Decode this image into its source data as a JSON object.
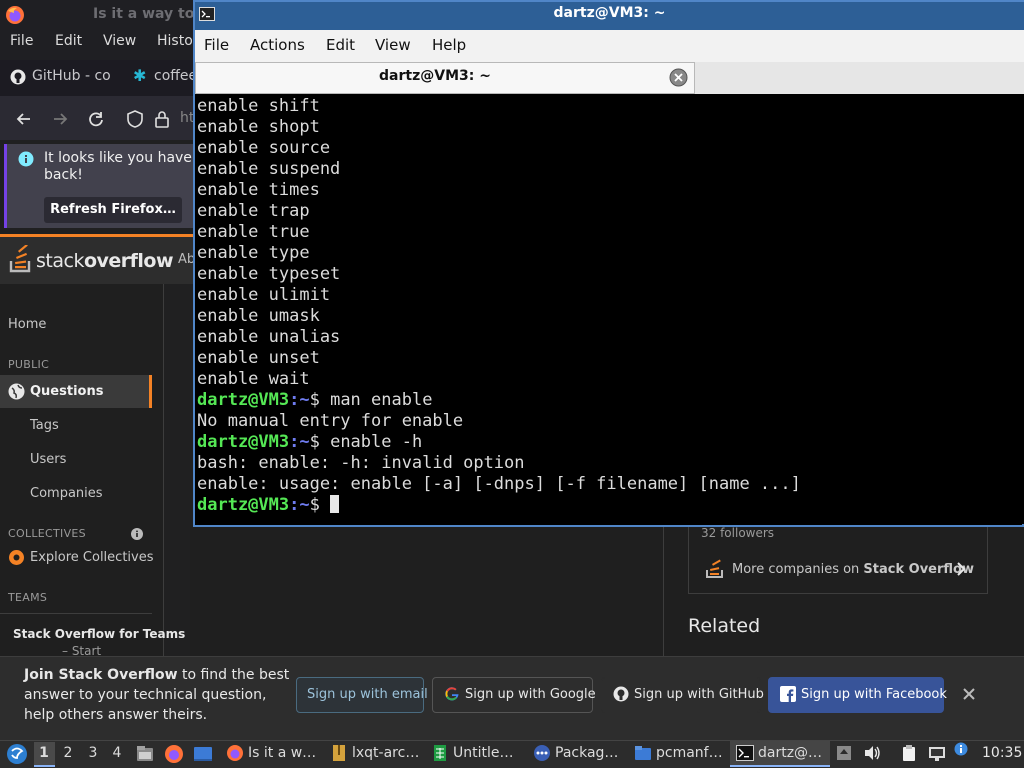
{
  "firefox": {
    "window_title": "Is it a way to",
    "menu": [
      "File",
      "Edit",
      "View",
      "Histo"
    ],
    "tabs": [
      "GitHub - co",
      "coffee"
    ],
    "url_partial": "ht",
    "notice": {
      "text": "It looks like you haven back!",
      "button": "Refresh Firefox…"
    }
  },
  "stackoverflow": {
    "wordmark_light": "stack",
    "wordmark_bold": "overflow",
    "topnav_about": "Ab",
    "nav": {
      "home": "Home",
      "public_header": "PUBLIC",
      "questions": "Questions",
      "tags": "Tags",
      "users": "Users",
      "companies": "Companies",
      "collectives_header": "COLLECTIVES",
      "explore_collectives": "Explore Collectives",
      "teams_header": "TEAMS",
      "teams_item": "Stack Overflow for Teams",
      "teams_start": "– Start"
    },
    "sidebar": {
      "followers": "32 followers",
      "more_companies_prefix": "More companies on ",
      "more_companies_bold": "Stack Overflow",
      "related": "Related"
    },
    "banner": {
      "bold": "Join Stack Overflow",
      "text": " to find the best answer to your technical question, help others answer theirs.",
      "signup_email": "Sign up with email",
      "signup_google": "Sign up with Google",
      "signup_github": "Sign up with GitHub",
      "signup_facebook": "Sign up with Facebook"
    }
  },
  "terminal": {
    "window_title": "dartz@VM3: ~",
    "menu": [
      "File",
      "Actions",
      "Edit",
      "View",
      "Help"
    ],
    "tab_label": "dartz@VM3: ~",
    "prompt_user": "dartz@VM3",
    "prompt_path": ":~",
    "prompt_symbol": "$ ",
    "lines": [
      {
        "type": "out",
        "text": "enable shift"
      },
      {
        "type": "out",
        "text": "enable shopt"
      },
      {
        "type": "out",
        "text": "enable source"
      },
      {
        "type": "out",
        "text": "enable suspend"
      },
      {
        "type": "out",
        "text": "enable times"
      },
      {
        "type": "out",
        "text": "enable trap"
      },
      {
        "type": "out",
        "text": "enable true"
      },
      {
        "type": "out",
        "text": "enable type"
      },
      {
        "type": "out",
        "text": "enable typeset"
      },
      {
        "type": "out",
        "text": "enable ulimit"
      },
      {
        "type": "out",
        "text": "enable umask"
      },
      {
        "type": "out",
        "text": "enable unalias"
      },
      {
        "type": "out",
        "text": "enable unset"
      },
      {
        "type": "out",
        "text": "enable wait"
      },
      {
        "type": "cmd",
        "text": "man enable"
      },
      {
        "type": "out",
        "text": "No manual entry for enable"
      },
      {
        "type": "cmd",
        "text": "enable -h"
      },
      {
        "type": "out",
        "text": "bash: enable: -h: invalid option"
      },
      {
        "type": "out",
        "text": "enable: usage: enable [-a] [-dnps] [-f filename] [name ...]"
      },
      {
        "type": "prompt",
        "text": ""
      }
    ]
  },
  "taskbar": {
    "workspaces": [
      "1",
      "2",
      "3",
      "4"
    ],
    "active_workspace": "1",
    "tasks": [
      "Is it a w…",
      "lxqt-arc…",
      "Untitle…",
      "Packag…",
      "pcmanf…",
      "dartz@…"
    ],
    "clock": "10:35"
  },
  "colors": {
    "terminal_border": "#5086c8",
    "prompt_user": "#55e855",
    "prompt_path": "#6f7cf0",
    "so_accent": "#f48225",
    "facebook_button": "#385499"
  }
}
